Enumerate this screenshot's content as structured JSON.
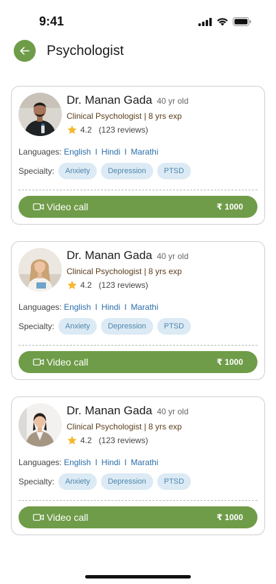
{
  "status_bar": {
    "time": "9:41"
  },
  "header": {
    "title": "Psychologist",
    "back_icon": "arrow-left-icon"
  },
  "colors": {
    "accent": "#6f9c48",
    "chip_bg": "#dbeaf4",
    "chip_text": "#4f86ad",
    "link": "#2b6ea8",
    "title_brown": "#5a3e1b"
  },
  "cards": [
    {
      "name": "Dr. Manan Gada",
      "age": "40 yr old",
      "title": "Clinical Psychologist | 8 yrs exp",
      "rating": "4.2",
      "reviews": "(123 reviews)",
      "languages_label": "Languages:",
      "languages": [
        "English",
        "Hindi",
        "Marathi"
      ],
      "language_separator": "I",
      "specialty_label": "Specialty:",
      "specialties": [
        "Anxiety",
        "Depression",
        "PTSD"
      ],
      "cta_label": "Video call",
      "price": "₹ 1000"
    },
    {
      "name": "Dr. Manan Gada",
      "age": "40 yr old",
      "title": "Clinical Psychologist | 8 yrs exp",
      "rating": "4.2",
      "reviews": "(123 reviews)",
      "languages_label": "Languages:",
      "languages": [
        "English",
        "Hindi",
        "Marathi"
      ],
      "language_separator": "I",
      "specialty_label": "Specialty:",
      "specialties": [
        "Anxiety",
        "Depression",
        "PTSD"
      ],
      "cta_label": "Video call",
      "price": "₹ 1000"
    },
    {
      "name": "Dr. Manan Gada",
      "age": "40 yr old",
      "title": "Clinical Psychologist | 8 yrs exp",
      "rating": "4.2",
      "reviews": "(123 reviews)",
      "languages_label": "Languages:",
      "languages": [
        "English",
        "Hindi",
        "Marathi"
      ],
      "language_separator": "I",
      "specialty_label": "Specialty:",
      "specialties": [
        "Anxiety",
        "Depression",
        "PTSD"
      ],
      "cta_label": "Video call",
      "price": "₹ 1000"
    }
  ]
}
